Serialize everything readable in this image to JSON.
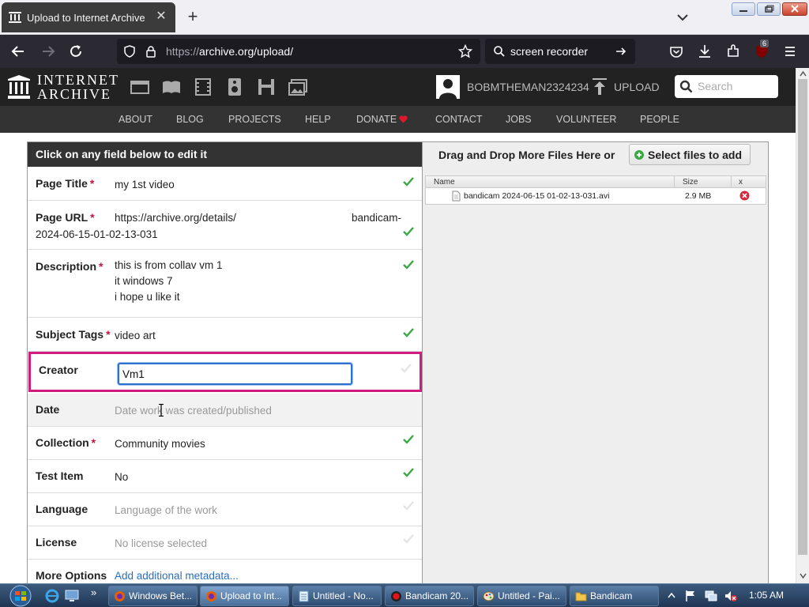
{
  "browser": {
    "tab_title": "Upload to Internet Archive",
    "url_prefix": "https://",
    "url_rest": "archive.org/upload/",
    "search_text": "screen recorder",
    "extension_badge": "6"
  },
  "site": {
    "logo_line1": "INTERNET",
    "logo_line2": "ARCHIVE",
    "username": "BOBMTHEMAN2324234",
    "upload_label": "UPLOAD",
    "search_placeholder": "Search",
    "nav": [
      "ABOUT",
      "BLOG",
      "PROJECTS",
      "HELP",
      "DONATE",
      "CONTACT",
      "JOBS",
      "VOLUNTEER",
      "PEOPLE"
    ]
  },
  "form": {
    "header": "Click on any field below to edit it",
    "fields": {
      "page_title": {
        "label": "Page Title",
        "value": "my 1st video"
      },
      "page_url": {
        "label": "Page URL",
        "value_part1": "https://archive.org/details/",
        "value_part2": "bandicam-",
        "value_line2": "2024-06-15-01-02-13-031"
      },
      "description": {
        "label": "Description",
        "lines": [
          "this is from collav vm 1",
          "it windows 7",
          "i hope u like it"
        ]
      },
      "subject_tags": {
        "label": "Subject Tags",
        "value": "video art"
      },
      "creator": {
        "label": "Creator",
        "value": "Vm1"
      },
      "date": {
        "label": "Date",
        "placeholder": "Date work was created/published"
      },
      "collection": {
        "label": "Collection",
        "value": "Community movies"
      },
      "test_item": {
        "label": "Test Item",
        "value": "No"
      },
      "language": {
        "label": "Language",
        "placeholder": "Language of the work"
      },
      "license": {
        "label": "License",
        "placeholder": "No license selected"
      },
      "more_options": {
        "label": "More Options",
        "link": "Add additional metadata..."
      }
    },
    "required_marker": "*"
  },
  "dropzone": {
    "heading": "Drag and Drop More Files Here or",
    "select_button": "Select files to add",
    "columns": {
      "name": "Name",
      "size": "Size",
      "remove": "x"
    },
    "files": [
      {
        "name": "bandicam 2024-06-15 01-02-13-031.avi",
        "size": "2.9 MB"
      }
    ]
  },
  "taskbar": {
    "tasks": [
      {
        "label": "Windows Bet..."
      },
      {
        "label": "Upload to Int..."
      },
      {
        "label": "Untitled - No..."
      },
      {
        "label": "Bandicam 20..."
      },
      {
        "label": "Untitled - Pai..."
      },
      {
        "label": "Bandicam"
      }
    ],
    "overflow": "»",
    "clock": "1:05 AM"
  },
  "colors": {
    "highlight_border": "#d11b7d",
    "check_green": "#3aa845",
    "required_red": "#c0143c"
  }
}
